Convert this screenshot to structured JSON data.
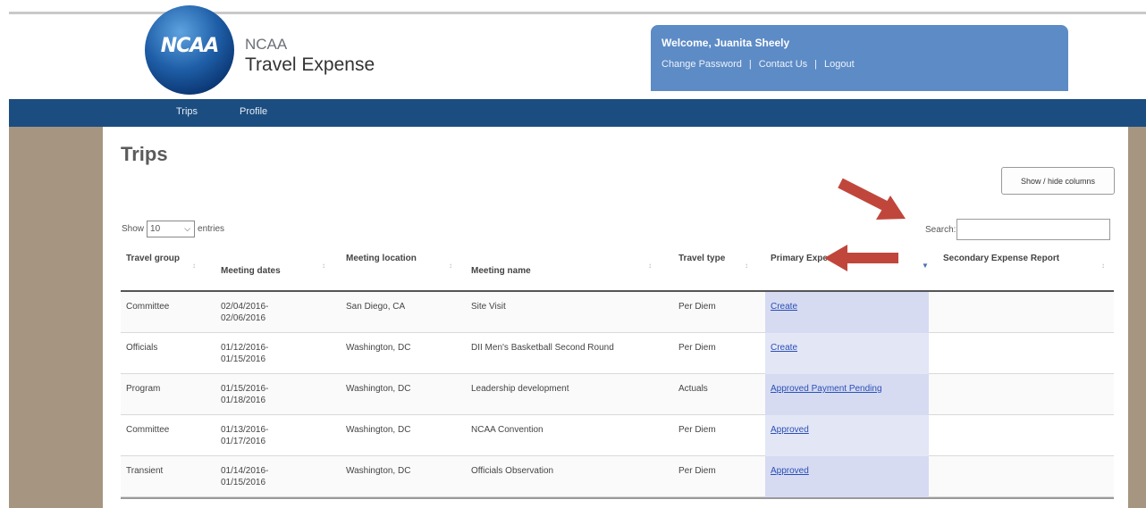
{
  "header": {
    "logo_text": "NCAA",
    "brand_small": "NCAA",
    "brand_title": "Travel Expense",
    "welcome": "Welcome, Juanita Sheely",
    "links": [
      "Change Password",
      "Contact Us",
      "Logout"
    ],
    "link_separator": "|"
  },
  "nav": {
    "items": [
      "Trips",
      "Profile"
    ]
  },
  "page": {
    "title": "Trips",
    "show_hide_label": "Show / hide columns",
    "show_label": "Show",
    "entries_value": "10",
    "entries_label": "entries",
    "search_label": "Search:",
    "search_value": ""
  },
  "table": {
    "headers": [
      "Travel group",
      "Meeting dates",
      "Meeting location",
      "Meeting name",
      "Travel type",
      "Primary Expense Report",
      "Secondary Expense Report"
    ],
    "rows": [
      {
        "group": "Committee",
        "dates": "02/04/2016-\n02/06/2016",
        "location": "San Diego, CA",
        "name": "Site Visit",
        "type": "Per Diem",
        "primary": "Create",
        "secondary": ""
      },
      {
        "group": "Officials",
        "dates": "01/12/2016-\n01/15/2016",
        "location": "Washington, DC",
        "name": "DII Men's Basketball Second Round",
        "type": "Per Diem",
        "primary": "Create",
        "secondary": ""
      },
      {
        "group": "Program",
        "dates": "01/15/2016-\n01/18/2016",
        "location": "Washington, DC",
        "name": "Leadership development",
        "type": "Actuals",
        "primary": "Approved Payment Pending",
        "secondary": ""
      },
      {
        "group": "Committee",
        "dates": "01/13/2016-\n01/17/2016",
        "location": "Washington, DC",
        "name": "NCAA Convention",
        "type": "Per Diem",
        "primary": "Approved",
        "secondary": ""
      },
      {
        "group": "Transient",
        "dates": "01/14/2016-\n01/15/2016",
        "location": "Washington, DC",
        "name": "Officials Observation",
        "type": "Per Diem",
        "primary": "Approved",
        "secondary": ""
      }
    ]
  },
  "colors": {
    "nav_bg": "#1c4d80",
    "welcome_bg": "#5d8bc6",
    "side_bg": "#a69580",
    "arrow": "#c0463b",
    "link": "#2a4fb5"
  },
  "icons": {
    "sort": "sort-icon",
    "sort_active": "sort-descending-icon",
    "dropdown": "chevron-down-icon"
  }
}
